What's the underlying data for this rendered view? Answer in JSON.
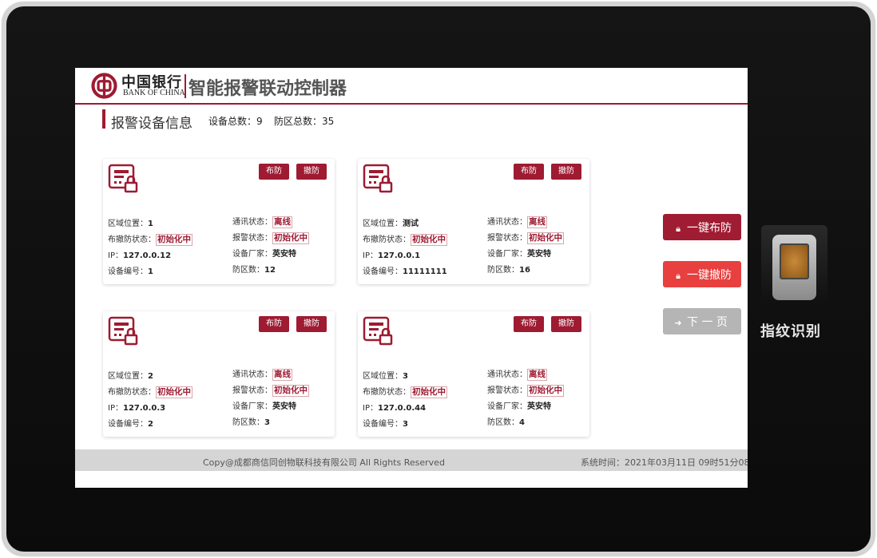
{
  "header": {
    "bank_name_cn": "中国银行",
    "bank_name_en": "BANK OF CHINA",
    "title": "智能报警联动控制器"
  },
  "section": {
    "title": "报警设备信息",
    "device_total": "设备总数：9",
    "zone_total": "防区总数：35"
  },
  "labels": {
    "arm": "布防",
    "disarm": "撤防",
    "area": "区域位置：",
    "arm_status": "布撤防状态：",
    "ip": "IP：",
    "device_no": "设备编号：",
    "comm_status": "通讯状态：",
    "alarm_status": "报警状态：",
    "vendor": "设备厂家：",
    "zone_count": "防区数："
  },
  "cards": [
    {
      "area": "1",
      "arm_status": "初始化中",
      "ip": "127.0.0.12",
      "device_no": "1",
      "comm_status": "离线",
      "alarm_status": "初始化中",
      "vendor": "英安特",
      "zone_count": "12"
    },
    {
      "area": "测试",
      "arm_status": "初始化中",
      "ip": "127.0.0.1",
      "device_no": "11111111",
      "comm_status": "离线",
      "alarm_status": "初始化中",
      "vendor": "英安特",
      "zone_count": "16"
    },
    {
      "area": "2",
      "arm_status": "初始化中",
      "ip": "127.0.0.3",
      "device_no": "2",
      "comm_status": "离线",
      "alarm_status": "初始化中",
      "vendor": "英安特",
      "zone_count": "3"
    },
    {
      "area": "3",
      "arm_status": "初始化中",
      "ip": "127.0.0.44",
      "device_no": "3",
      "comm_status": "离线",
      "alarm_status": "初始化中",
      "vendor": "英安特",
      "zone_count": "4"
    }
  ],
  "actions": {
    "arm_all": "一键布防",
    "disarm_all": "一键撤防",
    "next_page": "下 一 页"
  },
  "footer": {
    "copyright": "Copy@成都商信同创物联科技有限公司 All Rights Reserved",
    "system_time": "系统时间：2021年03月11日 09时51分08"
  },
  "fingerprint": {
    "label": "指纹识别"
  },
  "colors": {
    "brand": "#9e1b32",
    "disarm_all": "#e8403f",
    "next_page": "#b5b5b5"
  }
}
